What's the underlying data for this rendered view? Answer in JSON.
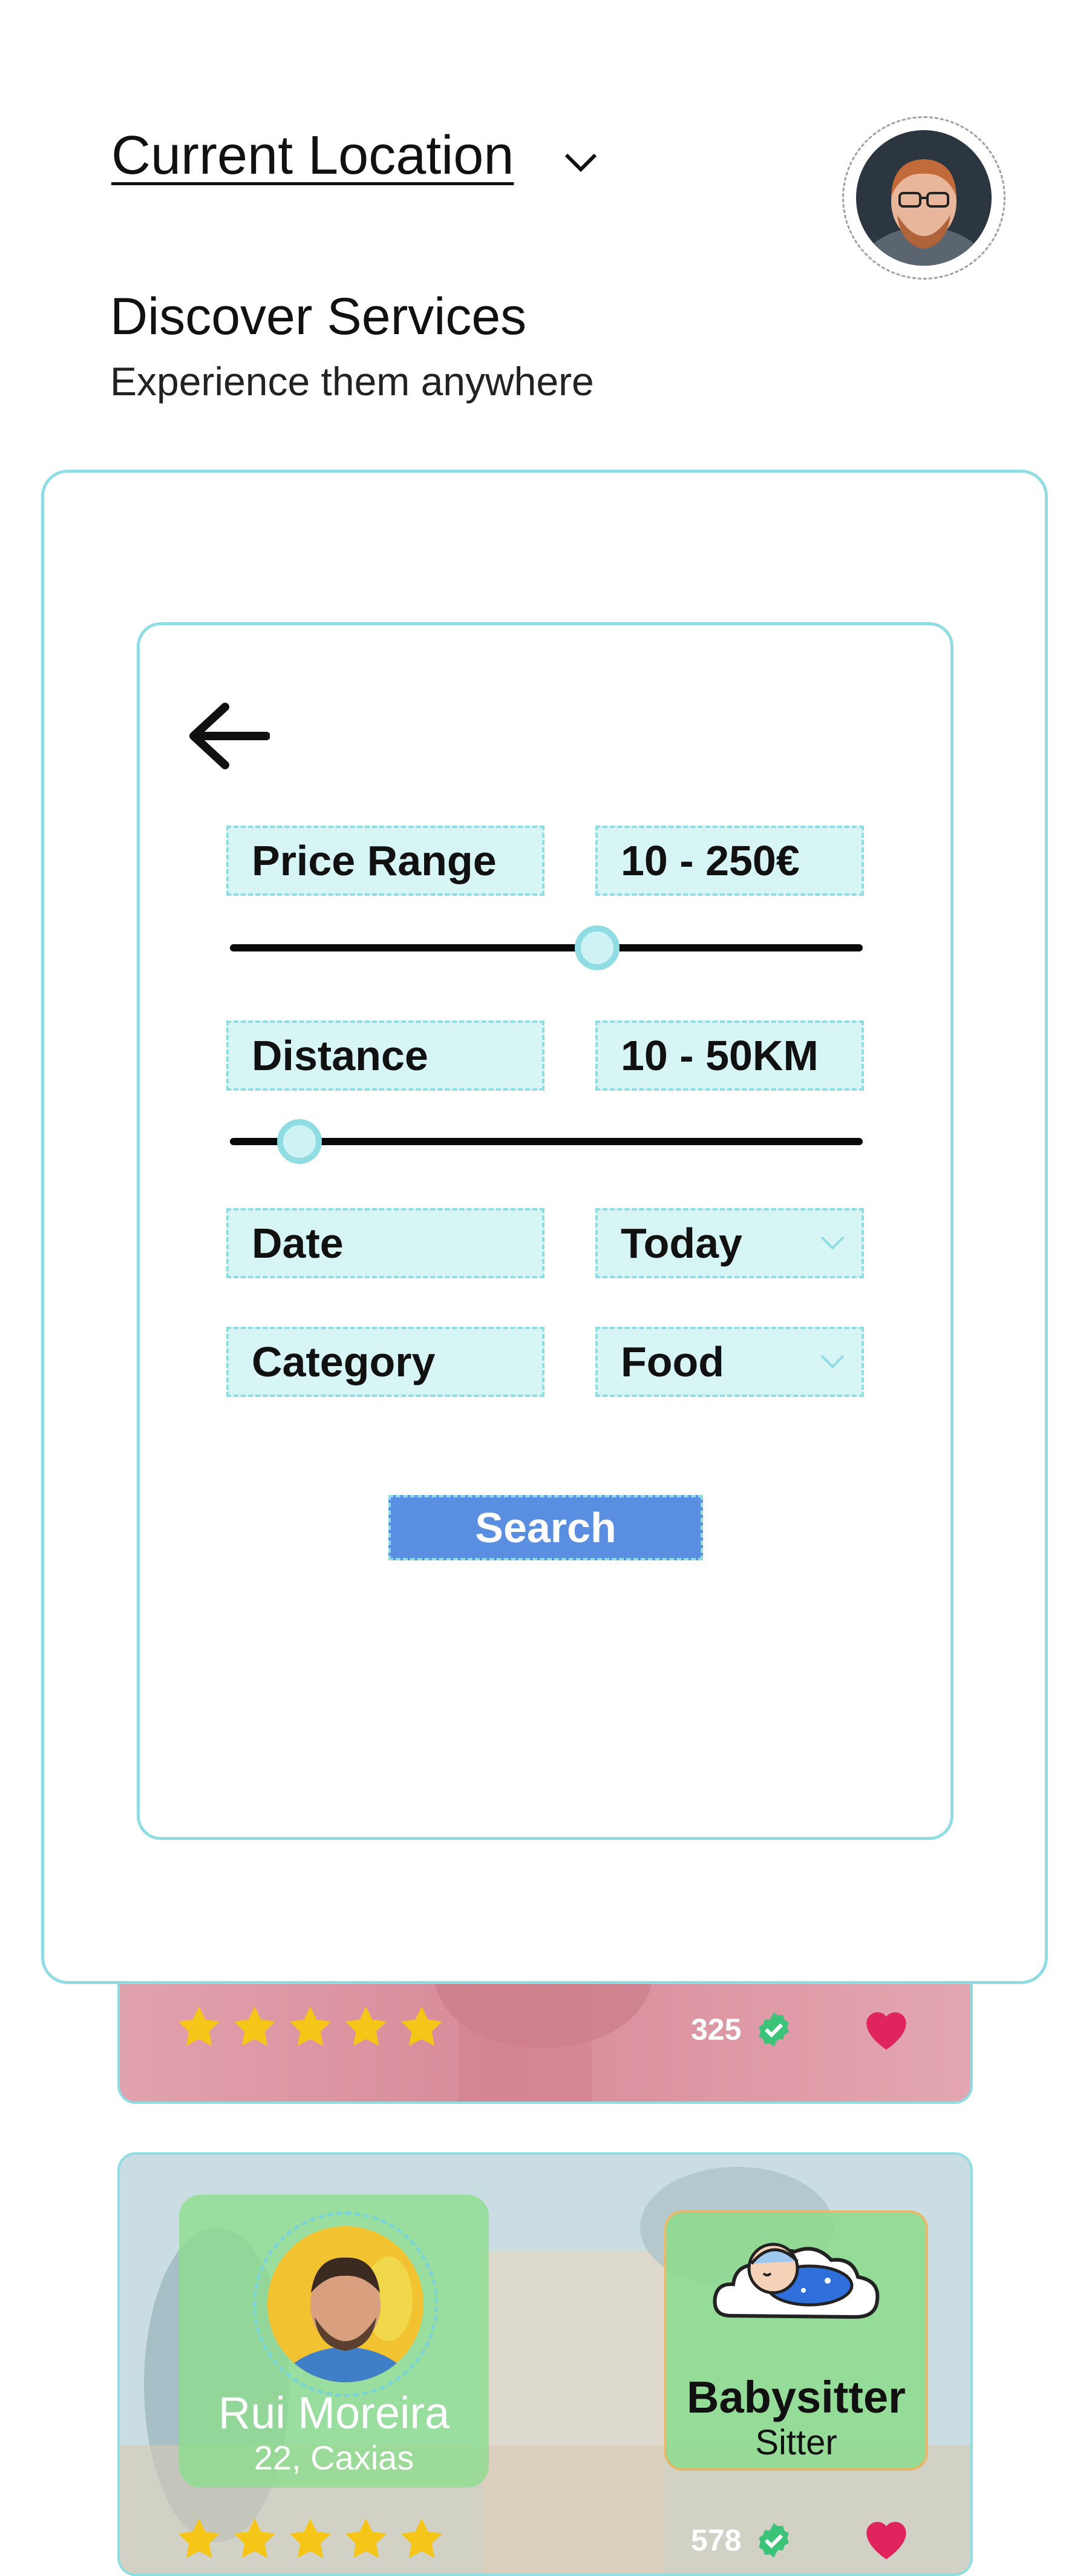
{
  "header": {
    "location_label": "Current Location",
    "title": "Discover Services",
    "subtitle": "Experience them anywhere"
  },
  "filters": {
    "price": {
      "label": "Price Range",
      "value": "10 -  250€",
      "slider_fraction": 0.58
    },
    "distance": {
      "label": "Distance",
      "value": "10 -  50KM",
      "slider_fraction": 0.11
    },
    "date": {
      "label": "Date",
      "value": "Today"
    },
    "category": {
      "label": "Category",
      "value": "Food"
    },
    "search_label": "Search"
  },
  "cards": [
    {
      "rating": 5,
      "reviews": "325",
      "verified": true,
      "favorite": true
    },
    {
      "name": "Rui Moreira",
      "location": "22, Caxias",
      "service": "Babysitter",
      "service_type": "Sitter",
      "rating": 5,
      "reviews": "578",
      "verified": true,
      "favorite": true
    }
  ],
  "colors": {
    "accent": "#8fdde3",
    "field_bg": "#d8f5f5",
    "button": "#5a8ee0",
    "star": "#f5c518",
    "heart": "#e0245e",
    "verified": "#3cc37a"
  },
  "icons": [
    "chevron-down-icon",
    "back-arrow-icon",
    "star-icon",
    "verified-icon",
    "heart-icon"
  ]
}
